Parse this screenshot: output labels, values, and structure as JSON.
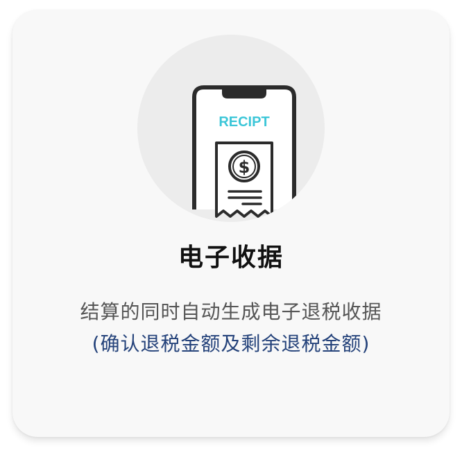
{
  "card": {
    "title": "电子收据",
    "description": "结算的同时自动生成电子退税收据",
    "note": "(确认退税金额及剩余退税金额)"
  },
  "illustration": {
    "screen_text": "RECIPT",
    "coin_symbol": "$",
    "icon": "phone-receipt-icon",
    "accent_color": "#3cc6d8",
    "circle_color": "#ececec"
  }
}
